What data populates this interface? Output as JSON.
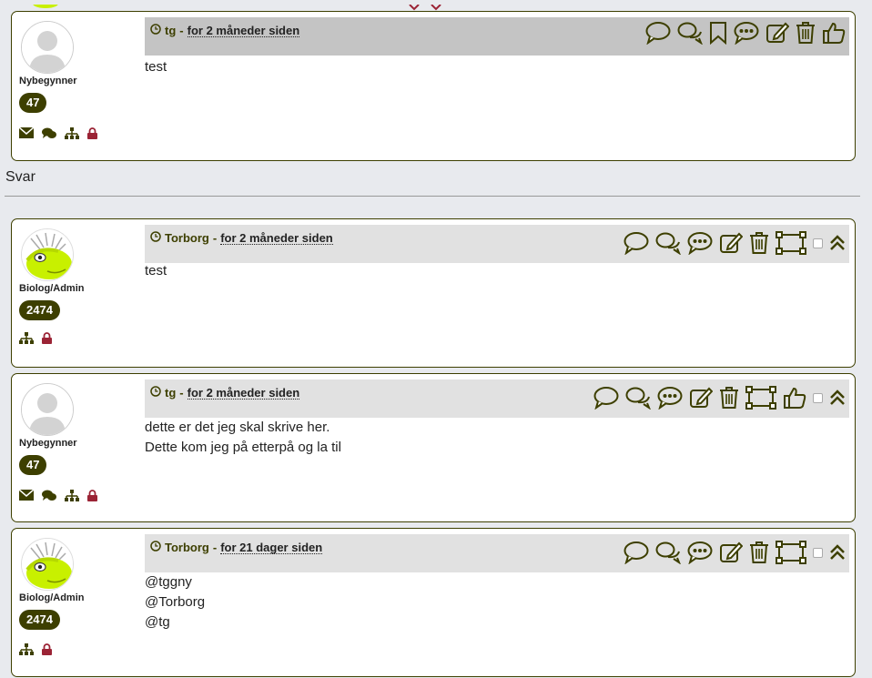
{
  "posts_top": [
    {
      "author": "tg",
      "time": "for 2 måneder siden",
      "rank": "Nybegynner",
      "count": "47",
      "avatar": "default-avatar",
      "user_icons": [
        "envelope-icon",
        "chat-bubbles-icon",
        "sitemap-icon",
        "lock-icon"
      ],
      "actions": [
        "comment-icon",
        "comments-icon",
        "bookmark-icon",
        "comment-dots-icon",
        "edit-icon",
        "trash-icon",
        "thumbs-up-icon"
      ],
      "lines": [
        "test"
      ]
    }
  ],
  "reply_heading": "Svar",
  "replies": [
    {
      "author": "Torborg",
      "time": "for 2 måneder siden",
      "rank": "Biolog/Admin",
      "count": "2474",
      "avatar": "admin-avatar",
      "user_icons": [
        "sitemap-icon",
        "lock-icon"
      ],
      "actions": [
        "comment-icon",
        "comments-icon",
        "comment-dots-icon",
        "edit-icon",
        "trash-icon",
        "select-frame-icon",
        "checkbox",
        "chevron-double-up-icon"
      ],
      "lines": [
        "test"
      ]
    },
    {
      "author": "tg",
      "time": "for 2 måneder siden",
      "rank": "Nybegynner",
      "count": "47",
      "avatar": "default-avatar",
      "user_icons": [
        "envelope-icon",
        "chat-bubbles-icon",
        "sitemap-icon",
        "lock-icon"
      ],
      "actions": [
        "comment-icon",
        "comments-icon",
        "comment-dots-icon",
        "edit-icon",
        "trash-icon",
        "select-frame-icon",
        "thumbs-up-icon",
        "checkbox",
        "chevron-double-up-icon"
      ],
      "lines": [
        "dette er det jeg skal skrive her.",
        "Dette kom jeg på etterpå og la til"
      ]
    },
    {
      "author": "Torborg",
      "time": "for 21 dager siden",
      "rank": "Biolog/Admin",
      "count": "2474",
      "avatar": "admin-avatar",
      "user_icons": [
        "sitemap-icon",
        "lock-icon"
      ],
      "actions": [
        "comment-icon",
        "comments-icon",
        "comment-dots-icon",
        "edit-icon",
        "trash-icon",
        "select-frame-icon",
        "checkbox",
        "chevron-double-up-icon"
      ],
      "lines": [
        "@tggny",
        "@Torborg",
        "@tg"
      ]
    }
  ],
  "colors": {
    "accent": "#3d3f00",
    "header_gray_top": "#c4c4c4",
    "header_gray": "#e1e1e1",
    "lock": "#9b2335",
    "admin_green": "#c8f000"
  }
}
